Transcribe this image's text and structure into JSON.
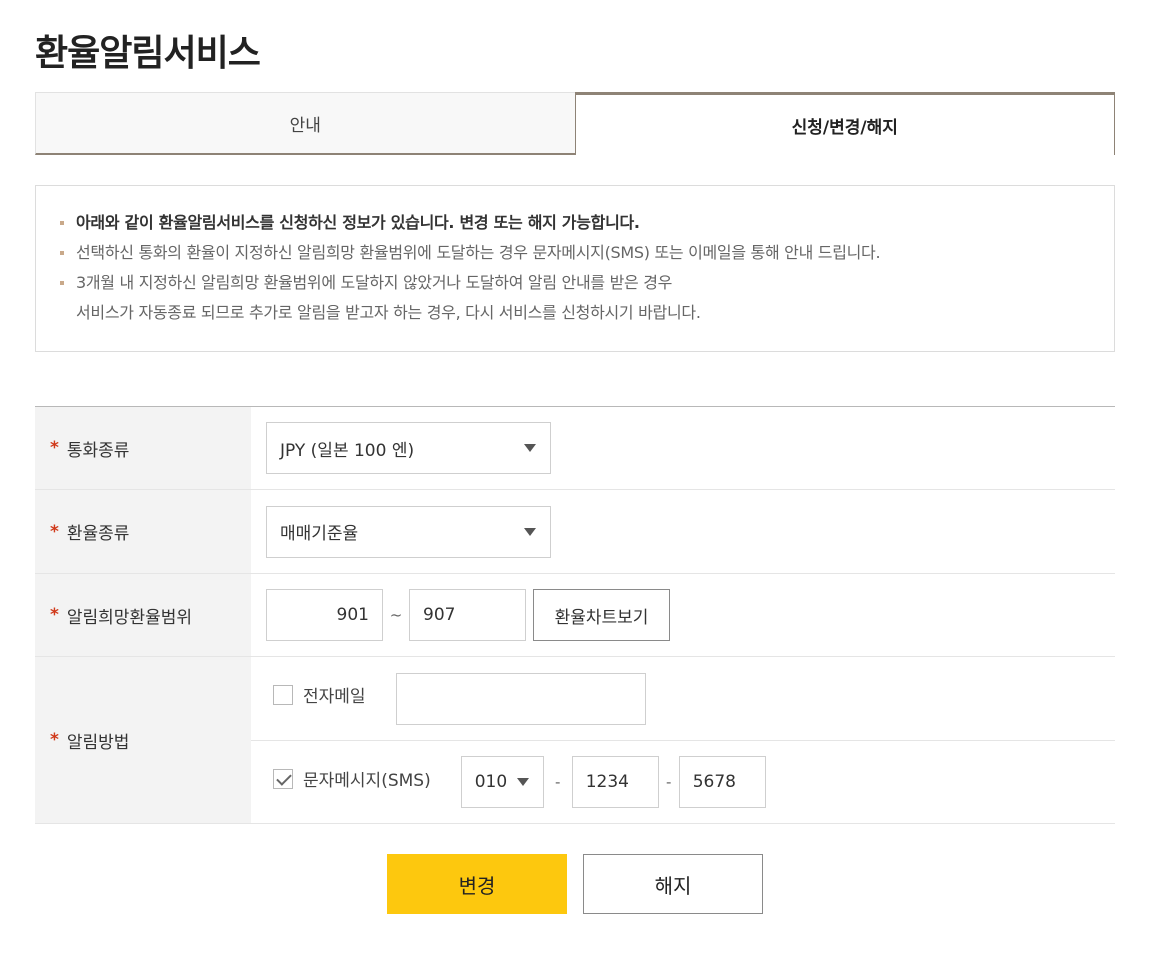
{
  "page_title": "환율알림서비스",
  "tabs": [
    {
      "label": "안내",
      "active": false
    },
    {
      "label": "신청/변경/해지",
      "active": true
    }
  ],
  "notice": {
    "items": [
      "아래와 같이 환율알림서비스를 신청하신 정보가 있습니다. 변경 또는 해지 가능합니다.",
      "선택하신 통화의 환율이 지정하신 알림희망 환율범위에 도달하는 경우 문자메시지(SMS) 또는 이메일을 통해 안내 드립니다.",
      "3개월 내 지정하신 알림희망 환율범위에 도달하지 않았거나 도달하여 알림 안내를 받은 경우"
    ],
    "item3_line2": "서비스가 자동종료 되므로 추가로 알림을 받고자 하는 경우, 다시 서비스를 신청하시기 바랍니다."
  },
  "form": {
    "required_mark": "*",
    "currency": {
      "label": "통화종류",
      "selected": "JPY (일본 100 엔)"
    },
    "rate_type": {
      "label": "환율종류",
      "selected": "매매기준율"
    },
    "range": {
      "label": "알림희망환율범위",
      "from": "901",
      "separator": "~",
      "to": "907",
      "chart_button": "환율차트보기"
    },
    "method": {
      "label": "알림방법",
      "email": {
        "label": "전자메일",
        "checked": false,
        "value": ""
      },
      "sms": {
        "label": "문자메시지(SMS)",
        "checked": true,
        "prefix": "010",
        "middle": "1234",
        "last": "5678",
        "dash": "-"
      }
    }
  },
  "buttons": {
    "change": "변경",
    "cancel": "해지"
  },
  "colors": {
    "accent": "#fdc80e",
    "tab_border": "#8e8376",
    "required": "#d0391a"
  }
}
